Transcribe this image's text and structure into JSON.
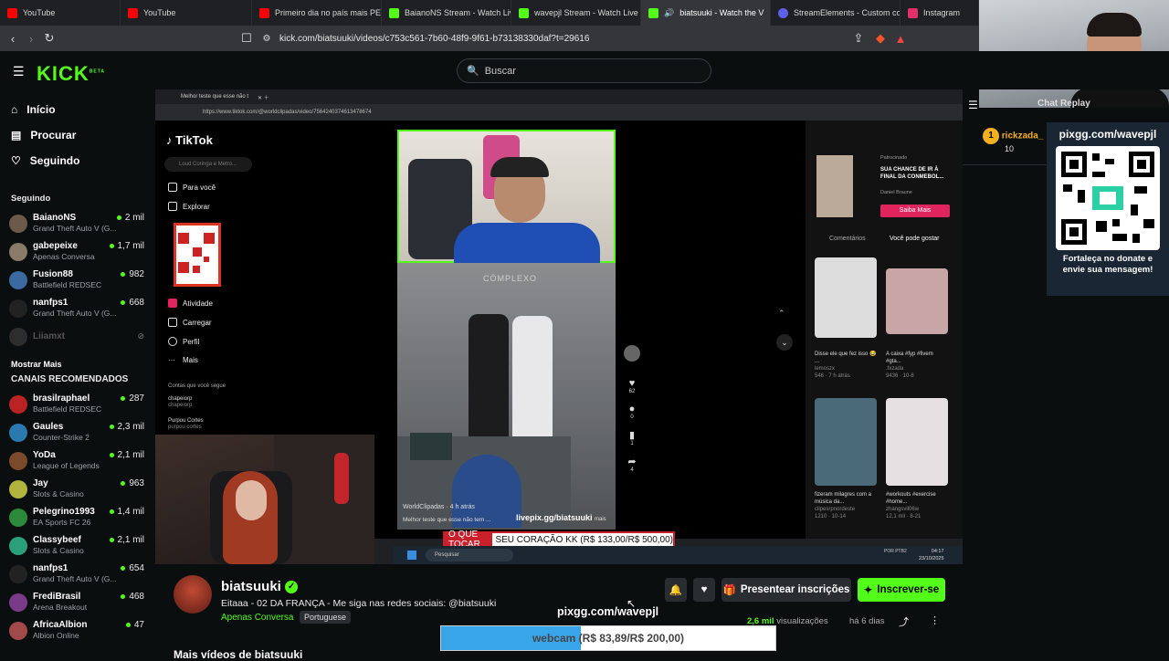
{
  "browser": {
    "tabs": [
      {
        "title": "YouTube",
        "color": "#ff0000"
      },
      {
        "title": "YouTube",
        "color": "#ff0000"
      },
      {
        "title": "Primeiro dia no país mais PERI",
        "color": "#ff0000"
      },
      {
        "title": "BaianoNS Stream - Watch Live",
        "color": "#53fc18"
      },
      {
        "title": "wavepjl Stream - Watch Live or",
        "color": "#53fc18"
      },
      {
        "title": "biatsuuki - Watch the V",
        "color": "#53fc18"
      },
      {
        "title": "StreamElements - Custom com",
        "color": "#5d5fef"
      },
      {
        "title": "Instagram",
        "color": "#e1306c"
      }
    ],
    "url": "kick.com/biatsuuki/videos/c753c561-7b60-48f9-9f61-b73138330daf?t=29616"
  },
  "header": {
    "logo": "KICK",
    "logo_badge": "BETA",
    "search_placeholder": "Buscar"
  },
  "sidebar": {
    "nav": [
      {
        "label": "Início",
        "icon": "home-icon"
      },
      {
        "label": "Procurar",
        "icon": "browse-icon"
      },
      {
        "label": "Seguindo",
        "icon": "heart-icon"
      }
    ],
    "following_title": "Seguindo",
    "following": [
      {
        "name": "BaianoNS",
        "game": "Grand Theft Auto V (G...",
        "viewers": "2 mil",
        "color": "#6b5a4a"
      },
      {
        "name": "gabepeixe",
        "game": "Apenas Conversa",
        "viewers": "1,7 mil",
        "color": "#8a7a6a"
      },
      {
        "name": "Fusion88",
        "game": "Battlefield REDSEC",
        "viewers": "982",
        "color": "#3a6aa0"
      },
      {
        "name": "nanfps1",
        "game": "Grand Theft Auto V (G...",
        "viewers": "668",
        "color": "#222"
      }
    ],
    "offline": {
      "name": "Liiamxt"
    },
    "show_more": "Mostrar Mais",
    "recommended_title": "CANAIS RECOMENDADOS",
    "recommended": [
      {
        "name": "brasilraphael",
        "game": "Battlefield REDSEC",
        "viewers": "287",
        "color": "#b22"
      },
      {
        "name": "Gaules",
        "game": "Counter-Strike 2",
        "viewers": "2,3 mil",
        "color": "#2a7ab0"
      },
      {
        "name": "YoDa",
        "game": "League of Legends",
        "viewers": "2,1 mil",
        "color": "#7a4a2a"
      },
      {
        "name": "Jay",
        "game": "Slots & Casino",
        "viewers": "963",
        "color": "#b0b43a"
      },
      {
        "name": "Pelegrino1993",
        "game": "EA Sports FC 26",
        "viewers": "1,4 mil",
        "color": "#2a8a3a"
      },
      {
        "name": "Classybeef",
        "game": "Slots & Casino",
        "viewers": "2,1 mil",
        "color": "#2aa07a"
      },
      {
        "name": "nanfps1",
        "game": "Grand Theft Auto V (G...",
        "viewers": "654",
        "color": "#222"
      },
      {
        "name": "FrediBrasil",
        "game": "Arena Breakout",
        "viewers": "468",
        "color": "#7a3a8a"
      },
      {
        "name": "AfricaAlbion",
        "game": "Albion Online",
        "viewers": "47",
        "color": "#a04a4a"
      }
    ]
  },
  "video": {
    "inner_tab": "Melhor teste que esse não t",
    "inner_url": "https://www.tiktok.com/@worldclipadas/video/7564240374613478674",
    "tiktok": {
      "logo": "TikTok",
      "search": "Loud Coringa e Metro...",
      "menu": [
        "Para você",
        "Explorar",
        "Atividade",
        "Carregar",
        "Perfil",
        "Mais"
      ],
      "follow_title": "Contas que você segue",
      "follows": [
        {
          "name": "chapeiorp",
          "handle": "chapeiorp"
        },
        {
          "name": "Purpou Cortes",
          "handle": "purpou cortes"
        }
      ],
      "author": "WorldClipadas",
      "author_time": "4 h atrás",
      "caption": "Melhor teste que esse não tem ...",
      "caption_more": "mais",
      "watermark": "livepix.gg/biatsuuki",
      "likes": "62",
      "comments": "0",
      "saves": "1",
      "shares": "4",
      "sponsored": "Patrocinado",
      "ad_title": "SUA CHANCE DE IR À FINAL DA CONMEBOL...",
      "ad_brand": "Daniel Braune",
      "ad_cta": "Saiba Mais",
      "tab_comments": "Comentários",
      "tab_like": "Você pode gostar",
      "suggestions": [
        {
          "title": "Disse ele que fez isso 😂 ...",
          "user": "lemoszx",
          "stats": "546 · 7 h atrás"
        },
        {
          "title": "A caixa #fyp #fivem #gta...",
          "user": ".fxzada",
          "stats": "9436 · 10-8"
        },
        {
          "title": "fizeram milagres com a música da...",
          "user": "clipesrpnordeste",
          "stats": "1210 · 10-14"
        },
        {
          "title": "#workouts #exercise #home...",
          "user": "zhangsvil06w",
          "stats": "12,1 mil · 8-21"
        }
      ]
    },
    "donation_label": "O QUE TOCAR",
    "donation_text": "SEU CORAÇÃO KK (R$ 133,00/R$ 500,00)",
    "donation_progress": 0.266,
    "taskbar_search": "Pesquisar",
    "clock": "04:17",
    "date": "23/10/2025",
    "tray_lang": "POR PTB2"
  },
  "chat": {
    "title": "Chat Replay",
    "message_user": "rickzada_",
    "message_text": "10",
    "qr_title": "pixgg.com/wavepjl",
    "qr_caption": "Fortaleça no donate e envie sua mensagem!"
  },
  "stream": {
    "channel": "biatsuuki",
    "title": "Eitaaa - 02 DA FRANÇA - Me siga nas redes sociais: @biatsuuki",
    "category": "Apenas Conversa",
    "language": "Portuguese",
    "views": "2,6 mil",
    "views_label": "visualizações",
    "age": "há 6 dias",
    "gift_label": "Presentear inscrições",
    "subscribe_label": "Inscrever-se",
    "more_videos": "Mais vídeos de biatsuuki"
  },
  "overlay": {
    "pix_url": "pixgg.com/wavepjl",
    "webcam_label": "webcam",
    "webcam_values": "(R$ 83,89/R$ 200,00)",
    "webcam_progress": 0.419
  },
  "colors": {
    "accent": "#53fc18",
    "background": "#0b0e0f",
    "webcam_fill": "#38a5e8"
  }
}
